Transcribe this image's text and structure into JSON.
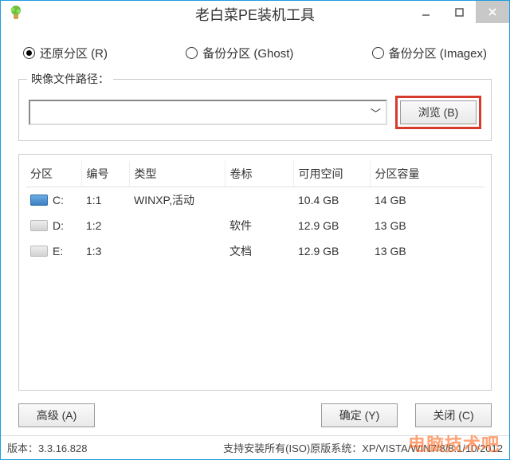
{
  "window": {
    "title": "老白菜PE装机工具"
  },
  "modes": {
    "restore": "还原分区 (R)",
    "backup_ghost": "备份分区 (Ghost)",
    "backup_imagex": "备份分区 (Imagex)",
    "selected": "restore"
  },
  "image_path": {
    "label": "映像文件路径：",
    "value": "",
    "browse": "浏览 (B)"
  },
  "table": {
    "headers": {
      "drive": "分区",
      "num": "编号",
      "type": "类型",
      "label": "卷标",
      "free": "可用空间",
      "size": "分区容量"
    },
    "rows": [
      {
        "drive": "C:",
        "icon": "c",
        "num": "1:1",
        "type": "WINXP,活动",
        "label": "",
        "free": "10.4 GB",
        "size": "14 GB"
      },
      {
        "drive": "D:",
        "icon": "g",
        "num": "1:2",
        "type": "",
        "label": "软件",
        "free": "12.9 GB",
        "size": "13 GB"
      },
      {
        "drive": "E:",
        "icon": "g",
        "num": "1:3",
        "type": "",
        "label": "文档",
        "free": "12.9 GB",
        "size": "13 GB"
      }
    ]
  },
  "buttons": {
    "advanced": "高级 (A)",
    "ok": "确定 (Y)",
    "close": "关闭 (C)"
  },
  "status": {
    "version_label": "版本：",
    "version": "3.3.16.828",
    "support": "支持安装所有(ISO)原版系统：XP/VISTA/WIN7/8/8.1/10/2012"
  },
  "watermark": "电脑技术吧"
}
